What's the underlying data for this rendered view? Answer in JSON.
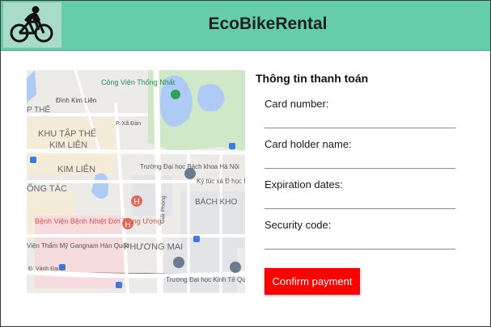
{
  "header": {
    "title": "EcoBikeRental",
    "logo_icon": "cyclist-icon",
    "background": "#66cdaa"
  },
  "map": {
    "labels": {
      "park": "Công Viên Thống Nhất",
      "dinh_kim_lien": "Đình Kim Liên",
      "khu_tap_the": "KHU TẬP THỂ",
      "kim_lien_1": "KIM LIÊN",
      "kim_lien_2": "KIM LIÊN",
      "tap_the_top": "P THỂ",
      "ong_tac": "ỐNG TÁC",
      "bach_khoa_uni": "Trường Đại học Bách khoa Hà Nội",
      "ky_tuc_xa": "Ký túc xá Đ học Bách kh",
      "bach_khoa_area": "BÁCH KHO",
      "hospital": "Bệnh Viện Bệnh Nhiệt Đới Trung Ương",
      "phuong_mai": "PHƯƠNG MAI",
      "vien_tham_my": "Viện Thẩm Mỹ Gangnam Hàn Quốc",
      "kinh_te_uni": "Trường Đại học Kinh Tế Quốc Dân",
      "giai_phong": "Giải Phóng",
      "vanh_dai": "Đ. Vành Đai 2",
      "xa_dan": "P. Xã Đàn"
    }
  },
  "payment": {
    "title": "Thông tin thanh toán",
    "fields": [
      {
        "label": "Card number:",
        "value": ""
      },
      {
        "label": "Card holder name:",
        "value": ""
      },
      {
        "label": "Expiration dates:",
        "value": ""
      },
      {
        "label": "Security code:",
        "value": ""
      }
    ],
    "confirm_label": "Confirm payment",
    "confirm_color": "#ff0000"
  }
}
